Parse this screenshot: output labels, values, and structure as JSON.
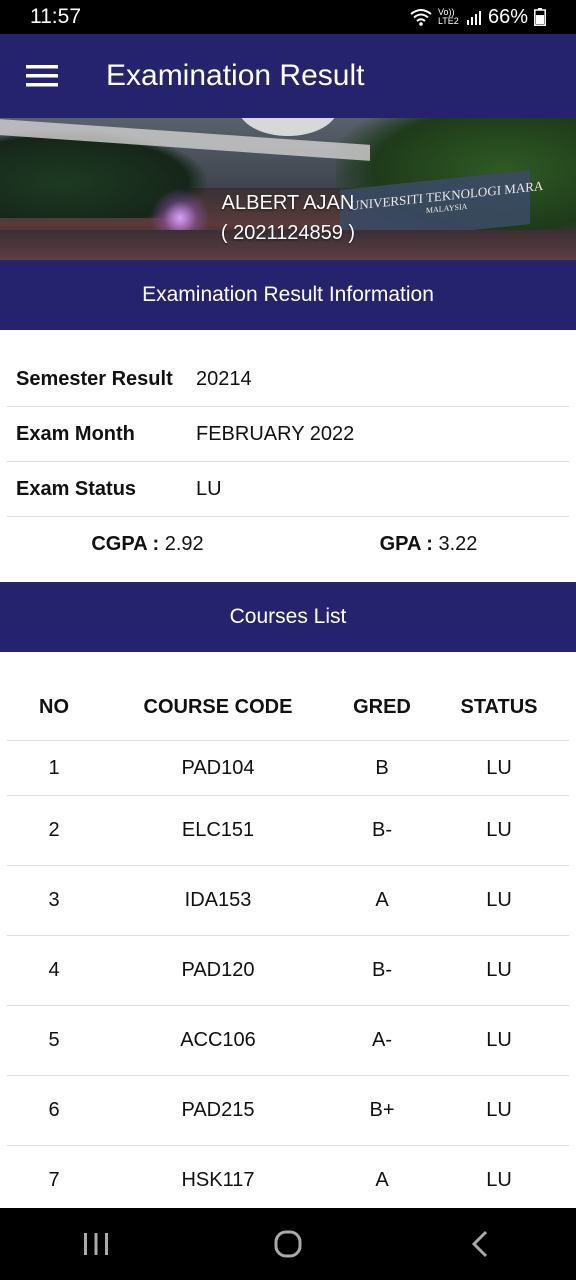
{
  "status_bar": {
    "time": "11:57",
    "network": "Vo)) LTE2",
    "battery": "66%"
  },
  "app_bar": {
    "title": "Examination Result",
    "menu_icon": "hamburger-menu-icon"
  },
  "banner": {
    "student_name": "ALBERT AJAN",
    "student_id": "( 2021124859 )",
    "sign_text": "UNIVERSITI TEKNOLOGI MARA",
    "sign_sub": "MALAYSIA"
  },
  "info_section": {
    "title": "Examination Result Information",
    "rows": [
      {
        "label": "Semester Result",
        "value": "20214"
      },
      {
        "label": "Exam Month",
        "value": "FEBRUARY 2022"
      },
      {
        "label": "Exam Status",
        "value": "LU"
      }
    ],
    "cgpa_label": "CGPA :",
    "cgpa_value": "2.92",
    "gpa_label": "GPA :",
    "gpa_value": "3.22"
  },
  "courses_section": {
    "title": "Courses List",
    "columns": [
      "NO",
      "COURSE CODE",
      "GRED",
      "STATUS"
    ],
    "rows": [
      {
        "no": "1",
        "code": "PAD104",
        "grade": "B",
        "status": "LU"
      },
      {
        "no": "2",
        "code": "ELC151",
        "grade": "B-",
        "status": "LU"
      },
      {
        "no": "3",
        "code": "IDA153",
        "grade": "A",
        "status": "LU"
      },
      {
        "no": "4",
        "code": "PAD120",
        "grade": "B-",
        "status": "LU"
      },
      {
        "no": "5",
        "code": "ACC106",
        "grade": "A-",
        "status": "LU"
      },
      {
        "no": "6",
        "code": "PAD215",
        "grade": "B+",
        "status": "LU"
      },
      {
        "no": "7",
        "code": "HSK117",
        "grade": "A",
        "status": "LU"
      }
    ]
  },
  "nav_bar": {
    "recent_icon": "recent-apps-icon",
    "home_icon": "home-icon",
    "back_icon": "back-icon"
  }
}
